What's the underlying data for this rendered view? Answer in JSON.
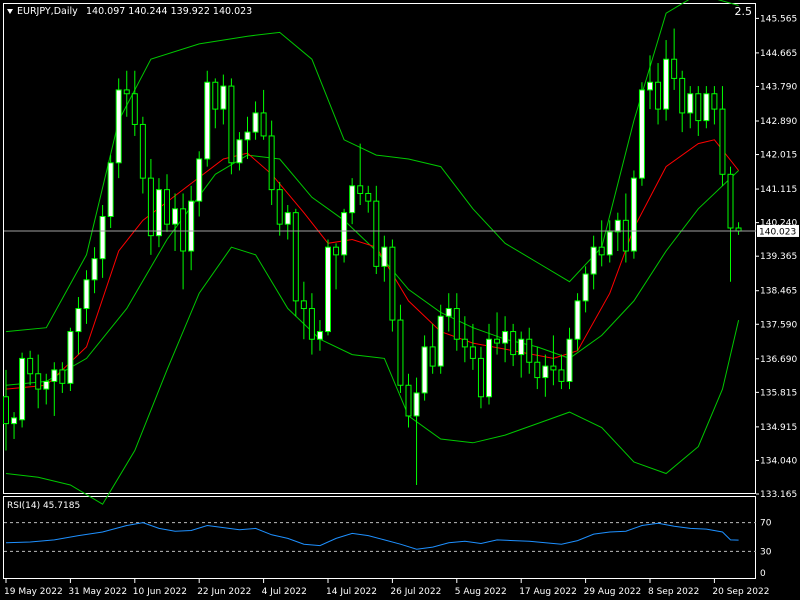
{
  "header": {
    "symbol_label": "EURJPY,Daily",
    "ohlc_values": "140.097 140.244 139.922 140.023",
    "zoom_label": "2.5"
  },
  "rsi_panel": {
    "label": "RSI(14) 45.7185",
    "levels": [
      70,
      30
    ],
    "ticks": [
      "70",
      "30",
      "0"
    ],
    "range": [
      0,
      100
    ]
  },
  "colors": {
    "background": "#000000",
    "frame": "#ffffff",
    "bull_fill": "#ffffff",
    "bear_fill": "#000000",
    "wick": "#00ff00",
    "bollinger": "#00c800",
    "moving_average": "#ff0000",
    "rsi_line": "#1e90ff",
    "bid_line": "#a0a0a0"
  },
  "chart_data": [
    {
      "type": "candlestick",
      "symbol": "EURJPY",
      "timeframe": "Daily",
      "current_price": 140.023,
      "current_price_label": "140.023",
      "y_ticks": [
        "145.565",
        "144.665",
        "143.790",
        "142.890",
        "142.015",
        "141.115",
        "140.240",
        "139.365",
        "138.465",
        "137.590",
        "136.690",
        "135.815",
        "134.915",
        "134.040",
        "133.165"
      ],
      "ylim": [
        133.165,
        145.94
      ],
      "x_ticks": [
        "19 May 2022",
        "31 May 2022",
        "10 Jun 2022",
        "22 Jun 2022",
        "4 Jul 2022",
        "14 Jul 2022",
        "26 Jul 2022",
        "5 Aug 2022",
        "17 Aug 2022",
        "29 Aug 2022",
        "8 Sep 2022",
        "20 Sep 2022"
      ],
      "x_tick_bars": [
        0,
        8,
        16,
        24,
        32,
        40,
        48,
        56,
        64,
        72,
        80,
        88
      ],
      "indicators": [
        "Bollinger Bands (upper, middle, lower)",
        "Moving Average"
      ],
      "ohlc": [
        [
          135.7,
          136.4,
          134.3,
          135.0
        ],
        [
          135.0,
          135.3,
          134.6,
          135.15
        ],
        [
          135.1,
          136.85,
          134.9,
          136.7
        ],
        [
          136.7,
          136.9,
          136.0,
          136.3
        ],
        [
          136.3,
          136.8,
          135.4,
          135.9
        ],
        [
          135.9,
          136.3,
          135.5,
          136.1
        ],
        [
          136.1,
          136.6,
          135.2,
          136.4
        ],
        [
          136.4,
          136.6,
          135.8,
          136.05
        ],
        [
          136.05,
          137.5,
          135.85,
          137.4
        ],
        [
          137.4,
          138.3,
          136.8,
          138.0
        ],
        [
          138.0,
          139.0,
          137.6,
          138.75
        ],
        [
          138.75,
          139.6,
          138.4,
          139.3
        ],
        [
          139.3,
          140.7,
          138.8,
          140.4
        ],
        [
          140.4,
          142.0,
          140.1,
          141.8
        ],
        [
          141.8,
          144.0,
          141.4,
          143.7
        ],
        [
          143.7,
          144.2,
          143.0,
          143.6
        ],
        [
          143.6,
          144.2,
          142.5,
          142.8
        ],
        [
          142.8,
          143.0,
          141.0,
          141.4
        ],
        [
          141.4,
          141.9,
          139.4,
          139.9
        ],
        [
          139.9,
          141.4,
          139.6,
          141.1
        ],
        [
          141.1,
          141.5,
          140.0,
          140.2
        ],
        [
          140.2,
          141.0,
          139.5,
          140.6
        ],
        [
          140.6,
          141.0,
          138.5,
          139.5
        ],
        [
          139.5,
          141.2,
          139.0,
          140.8
        ],
        [
          140.8,
          142.1,
          140.4,
          141.9
        ],
        [
          141.9,
          144.2,
          141.7,
          143.9
        ],
        [
          143.9,
          144.0,
          142.7,
          143.2
        ],
        [
          143.2,
          144.1,
          142.8,
          143.8
        ],
        [
          143.8,
          144.0,
          141.5,
          141.8
        ],
        [
          141.8,
          142.6,
          141.6,
          142.4
        ],
        [
          142.4,
          143.0,
          141.9,
          142.6
        ],
        [
          142.6,
          143.4,
          142.4,
          143.1
        ],
        [
          143.1,
          143.7,
          142.4,
          142.5
        ],
        [
          142.5,
          142.9,
          140.7,
          141.1
        ],
        [
          141.1,
          141.3,
          139.9,
          140.2
        ],
        [
          140.2,
          140.7,
          139.8,
          140.5
        ],
        [
          140.5,
          140.6,
          137.8,
          138.2
        ],
        [
          138.2,
          138.7,
          137.2,
          138.0
        ],
        [
          138.0,
          138.4,
          136.8,
          137.2
        ],
        [
          137.2,
          137.7,
          136.9,
          137.4
        ],
        [
          137.4,
          139.8,
          137.3,
          139.6
        ],
        [
          139.6,
          139.7,
          138.5,
          139.4
        ],
        [
          139.4,
          140.6,
          139.2,
          140.5
        ],
        [
          140.5,
          141.4,
          140.2,
          141.2
        ],
        [
          141.2,
          142.3,
          140.7,
          141.0
        ],
        [
          141.0,
          141.2,
          140.5,
          140.8
        ],
        [
          140.8,
          141.2,
          138.9,
          139.1
        ],
        [
          139.1,
          139.9,
          138.7,
          139.6
        ],
        [
          139.6,
          139.8,
          137.4,
          137.7
        ],
        [
          137.7,
          138.1,
          135.8,
          136.0
        ],
        [
          136.0,
          136.3,
          134.9,
          135.2
        ],
        [
          135.2,
          136.2,
          133.4,
          135.8
        ],
        [
          135.8,
          137.3,
          135.6,
          137.0
        ],
        [
          137.0,
          137.6,
          136.3,
          136.5
        ],
        [
          136.5,
          138.1,
          136.3,
          137.8
        ],
        [
          137.8,
          138.4,
          137.4,
          138.0
        ],
        [
          138.0,
          138.4,
          136.9,
          137.2
        ],
        [
          137.2,
          137.8,
          136.6,
          137.0
        ],
        [
          137.0,
          137.6,
          136.4,
          136.7
        ],
        [
          136.7,
          137.0,
          135.4,
          135.7
        ],
        [
          135.7,
          137.6,
          135.5,
          137.2
        ],
        [
          137.2,
          137.9,
          136.8,
          137.1
        ],
        [
          137.1,
          137.8,
          136.6,
          137.4
        ],
        [
          137.4,
          137.6,
          136.5,
          136.8
        ],
        [
          136.8,
          137.4,
          136.2,
          137.2
        ],
        [
          137.2,
          137.5,
          136.3,
          136.6
        ],
        [
          136.6,
          137.0,
          135.9,
          136.2
        ],
        [
          136.2,
          136.8,
          135.7,
          136.5
        ],
        [
          136.5,
          137.3,
          136.0,
          136.4
        ],
        [
          136.4,
          136.8,
          135.9,
          136.1
        ],
        [
          136.1,
          137.5,
          135.9,
          137.2
        ],
        [
          137.2,
          138.4,
          136.9,
          138.2
        ],
        [
          138.2,
          139.1,
          137.9,
          138.9
        ],
        [
          138.9,
          139.9,
          138.5,
          139.6
        ],
        [
          139.6,
          140.3,
          139.1,
          139.4
        ],
        [
          139.4,
          140.3,
          139.2,
          140.0
        ],
        [
          140.0,
          140.5,
          139.5,
          140.3
        ],
        [
          140.3,
          141.0,
          139.2,
          139.5
        ],
        [
          139.5,
          141.6,
          139.3,
          141.4
        ],
        [
          141.4,
          143.9,
          141.2,
          143.7
        ],
        [
          143.7,
          144.6,
          143.2,
          143.9
        ],
        [
          143.9,
          144.4,
          142.8,
          143.2
        ],
        [
          143.2,
          145.0,
          142.9,
          144.5
        ],
        [
          144.5,
          145.3,
          143.7,
          144.0
        ],
        [
          144.0,
          144.2,
          142.6,
          143.1
        ],
        [
          143.1,
          143.8,
          142.7,
          143.6
        ],
        [
          143.6,
          143.8,
          142.5,
          142.9
        ],
        [
          142.9,
          143.8,
          142.7,
          143.6
        ],
        [
          143.6,
          143.8,
          142.8,
          143.2
        ],
        [
          143.2,
          143.8,
          141.2,
          141.5
        ],
        [
          141.5,
          141.7,
          138.7,
          140.1
        ],
        [
          140.1,
          140.25,
          139.92,
          140.02
        ]
      ],
      "moving_average": [
        [
          0,
          135.9
        ],
        [
          5,
          136.0
        ],
        [
          10,
          137.0
        ],
        [
          14,
          139.5
        ],
        [
          17,
          140.3
        ],
        [
          22,
          141.1
        ],
        [
          27,
          141.9
        ],
        [
          30,
          142.05
        ],
        [
          33,
          141.5
        ],
        [
          37,
          140.5
        ],
        [
          40,
          139.7
        ],
        [
          43,
          139.8
        ],
        [
          46,
          139.6
        ],
        [
          50,
          138.2
        ],
        [
          54,
          137.4
        ],
        [
          58,
          137.1
        ],
        [
          63,
          136.9
        ],
        [
          68,
          136.7
        ],
        [
          71,
          136.9
        ],
        [
          75,
          138.4
        ],
        [
          78,
          140.1
        ],
        [
          82,
          141.7
        ],
        [
          86,
          142.3
        ],
        [
          88,
          142.4
        ],
        [
          91,
          141.6
        ]
      ],
      "bollinger_upper": [
        [
          0,
          137.4
        ],
        [
          5,
          137.5
        ],
        [
          10,
          139.4
        ],
        [
          14,
          142.9
        ],
        [
          18,
          144.5
        ],
        [
          24,
          144.9
        ],
        [
          30,
          145.1
        ],
        [
          34,
          145.2
        ],
        [
          38,
          144.5
        ],
        [
          42,
          142.4
        ],
        [
          46,
          142.0
        ],
        [
          50,
          141.9
        ],
        [
          54,
          141.7
        ],
        [
          58,
          140.6
        ],
        [
          62,
          139.7
        ],
        [
          66,
          139.2
        ],
        [
          70,
          138.7
        ],
        [
          74,
          139.6
        ],
        [
          78,
          142.9
        ],
        [
          82,
          145.7
        ],
        [
          86,
          146.2
        ],
        [
          91,
          145.9
        ]
      ],
      "bollinger_middle": [
        [
          0,
          136.0
        ],
        [
          5,
          136.1
        ],
        [
          10,
          136.7
        ],
        [
          15,
          138.0
        ],
        [
          20,
          139.8
        ],
        [
          26,
          141.5
        ],
        [
          30,
          142.0
        ],
        [
          34,
          141.9
        ],
        [
          38,
          140.9
        ],
        [
          42,
          140.3
        ],
        [
          46,
          139.5
        ],
        [
          50,
          138.5
        ],
        [
          54,
          137.9
        ],
        [
          58,
          137.5
        ],
        [
          62,
          137.2
        ],
        [
          66,
          137.0
        ],
        [
          70,
          136.7
        ],
        [
          74,
          137.3
        ],
        [
          78,
          138.2
        ],
        [
          82,
          139.5
        ],
        [
          86,
          140.6
        ],
        [
          91,
          141.6
        ]
      ],
      "bollinger_lower": [
        [
          0,
          133.7
        ],
        [
          4,
          133.6
        ],
        [
          8,
          133.4
        ],
        [
          12,
          132.9
        ],
        [
          16,
          134.3
        ],
        [
          20,
          136.4
        ],
        [
          24,
          138.4
        ],
        [
          28,
          139.6
        ],
        [
          31,
          139.4
        ],
        [
          35,
          138.0
        ],
        [
          39,
          137.2
        ],
        [
          43,
          136.8
        ],
        [
          47,
          136.7
        ],
        [
          50,
          135.2
        ],
        [
          54,
          134.6
        ],
        [
          58,
          134.5
        ],
        [
          62,
          134.7
        ],
        [
          66,
          135.0
        ],
        [
          70,
          135.3
        ],
        [
          74,
          134.9
        ],
        [
          78,
          134.0
        ],
        [
          82,
          133.7
        ],
        [
          86,
          134.4
        ],
        [
          89,
          135.9
        ],
        [
          91,
          137.7
        ]
      ]
    },
    {
      "type": "line",
      "name": "RSI(14)",
      "ylim": [
        0,
        100
      ],
      "values": [
        [
          0,
          42
        ],
        [
          3,
          43
        ],
        [
          6,
          46
        ],
        [
          9,
          52
        ],
        [
          12,
          57
        ],
        [
          15,
          66
        ],
        [
          17,
          70
        ],
        [
          19,
          62
        ],
        [
          21,
          58
        ],
        [
          23,
          59
        ],
        [
          25,
          66
        ],
        [
          27,
          63
        ],
        [
          29,
          60
        ],
        [
          31,
          62
        ],
        [
          33,
          53
        ],
        [
          35,
          48
        ],
        [
          37,
          40
        ],
        [
          39,
          38
        ],
        [
          41,
          48
        ],
        [
          43,
          55
        ],
        [
          45,
          52
        ],
        [
          47,
          46
        ],
        [
          49,
          40
        ],
        [
          51,
          33
        ],
        [
          53,
          36
        ],
        [
          55,
          42
        ],
        [
          57,
          44
        ],
        [
          59,
          41
        ],
        [
          61,
          46
        ],
        [
          63,
          45
        ],
        [
          65,
          44
        ],
        [
          67,
          42
        ],
        [
          69,
          40
        ],
        [
          71,
          45
        ],
        [
          73,
          54
        ],
        [
          75,
          57
        ],
        [
          77,
          58
        ],
        [
          79,
          66
        ],
        [
          81,
          69
        ],
        [
          83,
          65
        ],
        [
          85,
          62
        ],
        [
          87,
          61
        ],
        [
          89,
          57
        ],
        [
          90,
          46
        ],
        [
          91,
          45.7
        ]
      ]
    }
  ]
}
